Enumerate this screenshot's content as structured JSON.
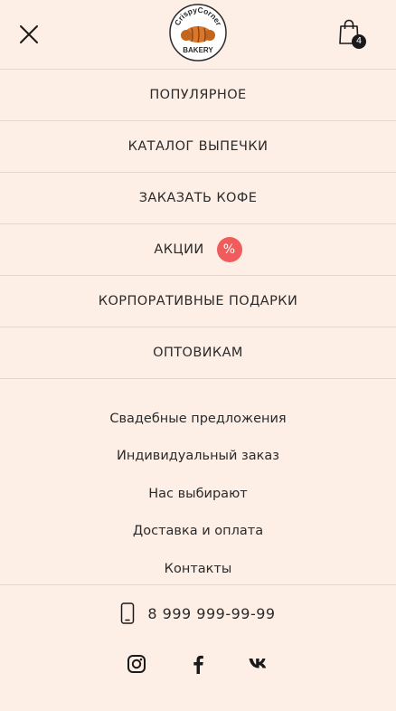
{
  "header": {
    "logo_top_text": "CrispyCorner",
    "logo_bottom_text": "BAKERY",
    "cart_count": "4"
  },
  "menu": {
    "items": [
      {
        "label": "ПОПУЛЯРНОЕ"
      },
      {
        "label": "КАТАЛОГ ВЫПЕЧКИ"
      },
      {
        "label": "ЗАКАЗАТЬ КОФЕ"
      },
      {
        "label": "АКЦИИ",
        "badge": "%"
      },
      {
        "label": "КОРПОРАТИВНЫЕ ПОДАРКИ"
      },
      {
        "label": "ОПТОВИКАМ"
      }
    ]
  },
  "secondary": {
    "items": [
      {
        "label": "Свадебные предложения"
      },
      {
        "label": "Индивидуальный заказ"
      },
      {
        "label": "Нас выбирают"
      },
      {
        "label": "Доставка и оплата"
      },
      {
        "label": "Контакты"
      }
    ]
  },
  "contact": {
    "phone": "8 999 999-99-99"
  },
  "social": {
    "icons": [
      "instagram-icon",
      "facebook-icon",
      "vk-icon"
    ]
  },
  "colors": {
    "background": "#fdeee6",
    "divider": "#e2d6cf",
    "sale_badge": "#f05c5c",
    "text": "#2b2b2b",
    "logo_bread": "#d9772a"
  }
}
